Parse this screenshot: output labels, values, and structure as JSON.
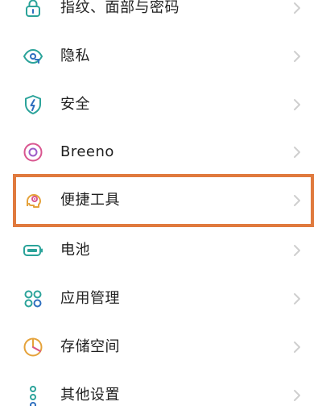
{
  "settings": {
    "items": [
      {
        "label": "指纹、面部与密码",
        "icon": "lock-icon"
      },
      {
        "label": "隐私",
        "icon": "privacy-eye-icon"
      },
      {
        "label": "安全",
        "icon": "shield-icon"
      },
      {
        "label": "Breeno",
        "icon": "breeno-icon"
      },
      {
        "label": "便捷工具",
        "icon": "convenience-tools-icon"
      },
      {
        "label": "电池",
        "icon": "battery-icon"
      },
      {
        "label": "应用管理",
        "icon": "app-management-icon"
      },
      {
        "label": "存储空间",
        "icon": "storage-icon"
      },
      {
        "label": "其他设置",
        "icon": "other-settings-icon"
      }
    ]
  },
  "highlight": {
    "target": "便捷工具",
    "color": "#E07A3E"
  },
  "colors": {
    "icon_teal": "#2BA39A",
    "icon_blue": "#2E6FBF",
    "icon_pink": "#D9558F",
    "icon_amber": "#E5A23A",
    "chevron": "#cfcfcf"
  }
}
